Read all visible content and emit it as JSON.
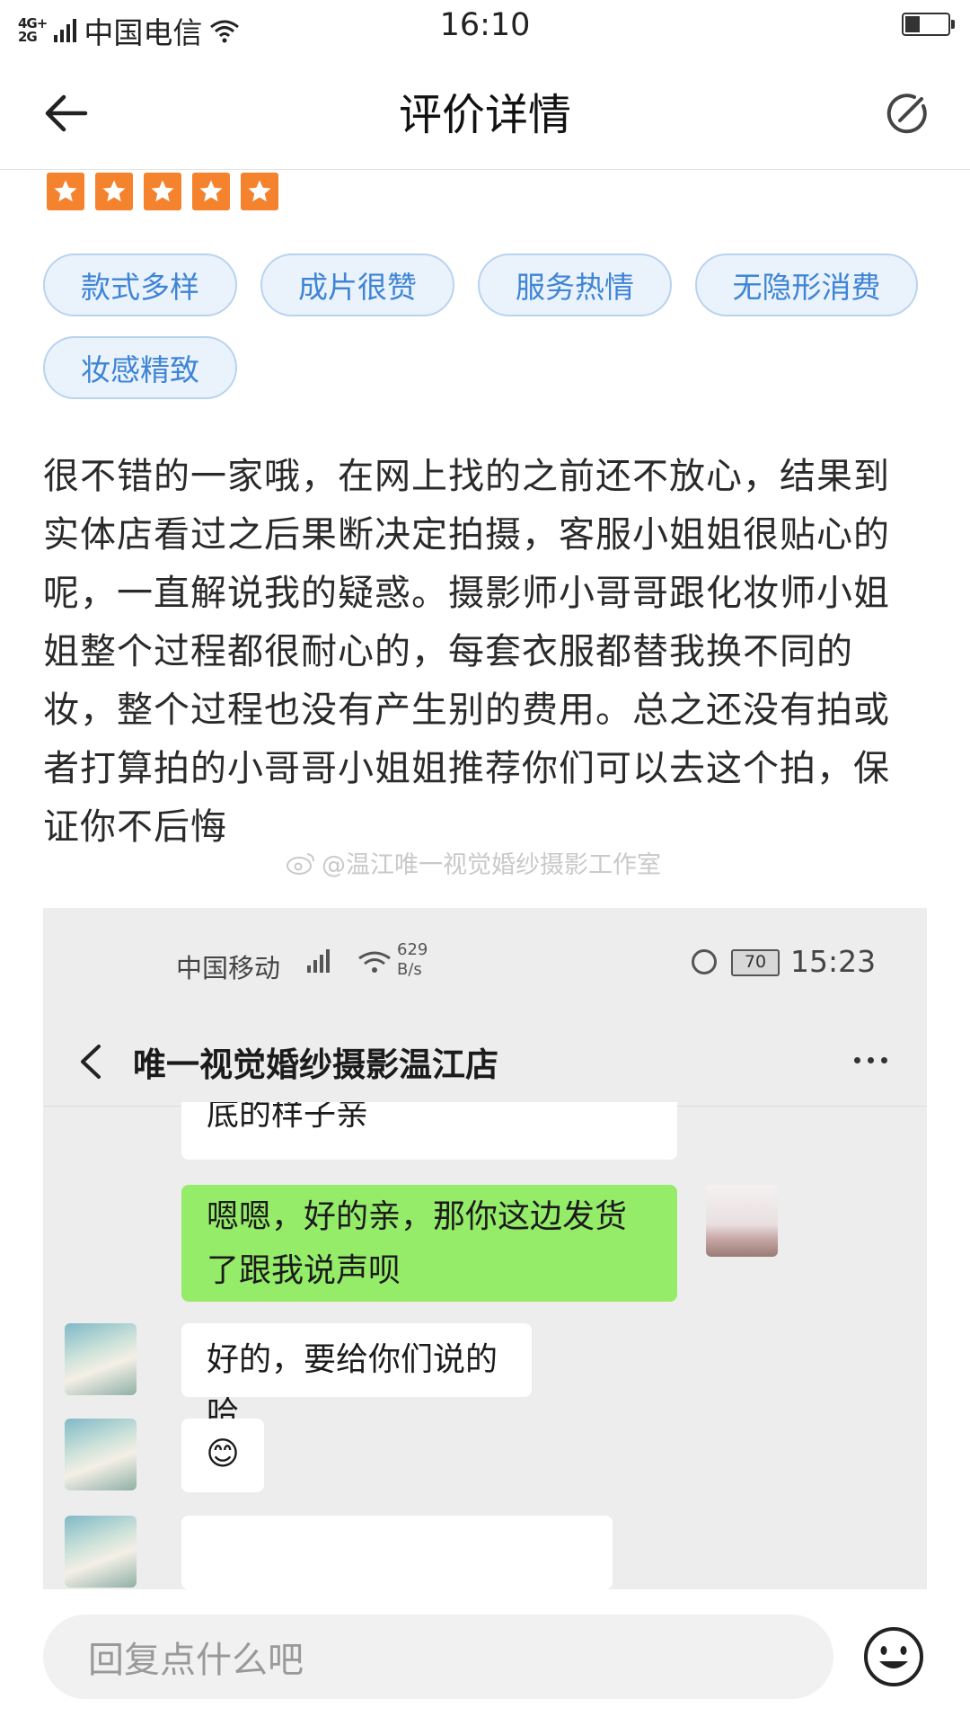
{
  "status_bar": {
    "network": "4G+\n2G",
    "carrier": "中国电信",
    "time": "16:10"
  },
  "nav": {
    "title": "评价详情"
  },
  "rating": {
    "stars": 5,
    "max": 5,
    "color": "#f5822d"
  },
  "tags": [
    "款式多样",
    "成片很赞",
    "服务热情",
    "无隐形消费",
    "妆感精致"
  ],
  "review_text": "很不错的一家哦，在网上找的之前还不放心，结果到实体店看过之后果断决定拍摄，客服小姐姐很贴心的呢，一直解说我的疑惑。摄影师小哥哥跟化妆师小姐姐整个过程都很耐心的，每套衣服都替我换不同的妆，整个过程也没有产生别的费用。总之还没有拍或者打算拍的小哥哥小姐姐推荐你们可以去这个拍，保证你不后悔",
  "watermark": "@温江唯一视觉婚纱摄影工作室",
  "screenshot": {
    "carrier": "中国移动",
    "speed_value": "629",
    "speed_unit": "B/s",
    "battery": "70",
    "time": "15:23",
    "chat_title": "唯一视觉婚纱摄影温江店",
    "messages": [
      {
        "side": "left",
        "text": "底的样子亲"
      },
      {
        "side": "right",
        "text": "嗯嗯，好的亲，那你这边发货了跟我说声呗"
      },
      {
        "side": "left",
        "text": "好的，要给你们说的哈"
      },
      {
        "side": "left",
        "text": "😊"
      }
    ]
  },
  "reply": {
    "placeholder": "回复点什么吧"
  }
}
